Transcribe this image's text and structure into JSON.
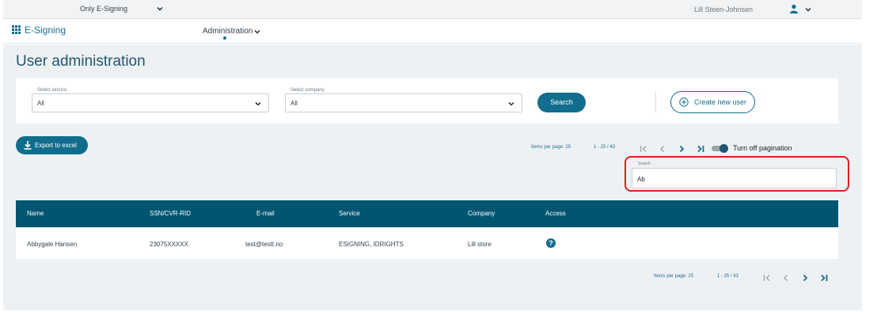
{
  "topbar": {
    "service_selector": "Only E-Signing",
    "user_name": "Lill Steen-Johnsen"
  },
  "nav": {
    "app_name": "E-Signing",
    "menu": "Administration"
  },
  "page": {
    "title": "User administration"
  },
  "filters": {
    "service_label": "Select service",
    "service_value": "All",
    "company_label": "Select company",
    "company_value": "All",
    "search_button": "Search",
    "create_button": "Create new user"
  },
  "toolbar": {
    "export_button": "Export to excel",
    "items_per_page": "Items per page: 25",
    "range": "1 - 25 / 43",
    "pagination_toggle_label": "Turn off pagination",
    "pagination_toggle_on": true
  },
  "search": {
    "label": "Search",
    "value": "Ab"
  },
  "table": {
    "columns": [
      "Name",
      "SSN/CVR-RID",
      "E-mail",
      "Service",
      "Company",
      "Access"
    ],
    "rows": [
      {
        "name": "Abbygale Hansen",
        "ssn": "23075XXXXX",
        "email": "test@testt.no",
        "service": "ESIGNING, IDRIGHTS",
        "company": "Lill store",
        "access_icon": "help-icon"
      }
    ]
  },
  "pager_bottom": {
    "items_per_page": "Items per page: 25",
    "range": "1 - 25 / 43"
  },
  "colors": {
    "primary": "#116d8e",
    "header": "#005571",
    "highlight": "#e01f1f",
    "background": "#eef1f4"
  }
}
